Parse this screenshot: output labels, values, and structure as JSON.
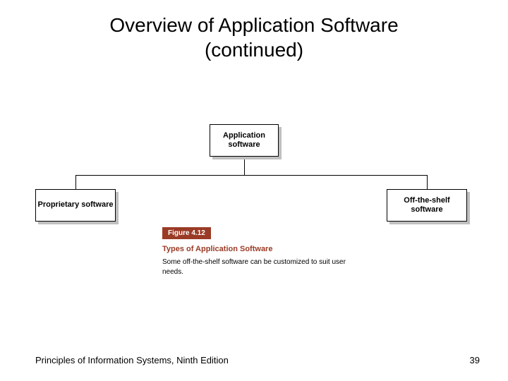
{
  "title_line1": "Overview of Application Software",
  "title_line2": "(continued)",
  "diagram": {
    "root": "Application software",
    "left": "Proprietary software",
    "right": "Off-the-shelf software"
  },
  "figure": {
    "badge": "Figure 4.12",
    "title": "Types of Application Software",
    "caption": "Some off-the-shelf software can be customized to suit user needs."
  },
  "footer": {
    "source": "Principles of Information Systems, Ninth Edition",
    "page": "39"
  }
}
